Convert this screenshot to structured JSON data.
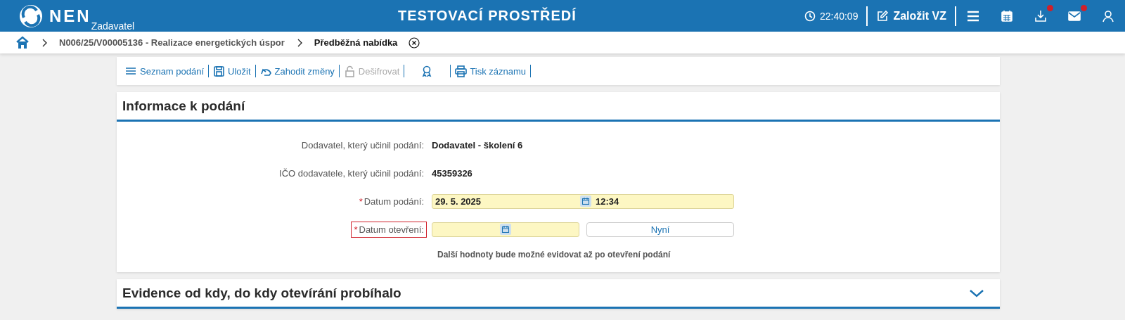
{
  "header": {
    "logo": "NEN",
    "logo_sub": "Zadavatel",
    "title": "TESTOVACÍ PROSTŘEDÍ",
    "time": "22:40:09",
    "create_button": "Založit VZ",
    "icons": [
      {
        "kind": "menu",
        "dot": false
      },
      {
        "kind": "calendar",
        "dot": false
      },
      {
        "kind": "download",
        "dot": true
      },
      {
        "kind": "mail",
        "dot": true
      },
      {
        "kind": "user",
        "dot": false
      }
    ]
  },
  "breadcrumb": [
    {
      "label": "N006/25/V00005136 - Realizace energetických úspor",
      "current": false
    },
    {
      "label": "Předběžná nabídka",
      "current": true
    }
  ],
  "toolbar": [
    {
      "kind": "list",
      "label": "Seznam podání",
      "disabled": false
    },
    {
      "kind": "save",
      "label": "Uložit",
      "disabled": false
    },
    {
      "kind": "undo",
      "label": "Zahodit změny",
      "disabled": false
    },
    {
      "kind": "unlock",
      "label": "Dešifrovat",
      "disabled": true
    },
    {
      "kind": "award",
      "disabled": false
    },
    {
      "kind": "print",
      "label": "Tisk záznamu",
      "disabled": false
    }
  ],
  "sections": [
    {
      "title": "Informace k podání",
      "expanded": true,
      "fields": [
        {
          "kind": "text",
          "label": "Dodavatel, který učinil podání:",
          "invalid": false,
          "value": "Dodavatel - školení 6"
        },
        {
          "kind": "text",
          "label": "IČO dodavatele, který učinil podání:",
          "invalid": false,
          "value": "45359326"
        },
        {
          "kind": "datetime",
          "label": "Datum podání:",
          "required_mark": "*",
          "invalid": false,
          "value": "29. 5. 2025",
          "time": "12:34"
        },
        {
          "kind": "date_now",
          "label": "Datum otevření:",
          "required_mark": "*",
          "invalid": true,
          "button": "Nyní"
        }
      ],
      "note": "Další hodnoty bude možné evidovat až po otevření podání"
    },
    {
      "title": "Evidence od kdy, do kdy otevírání probíhalo",
      "expanded": false
    }
  ]
}
